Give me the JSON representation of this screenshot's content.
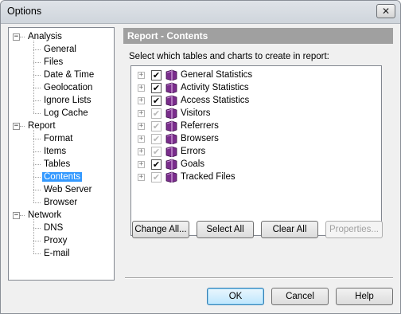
{
  "window": {
    "title": "Options",
    "close_glyph": "✕"
  },
  "tree": {
    "items": [
      {
        "label": "Analysis",
        "level": 0,
        "expander": "−"
      },
      {
        "label": "General",
        "level": 1
      },
      {
        "label": "Files",
        "level": 1
      },
      {
        "label": "Date & Time",
        "level": 1
      },
      {
        "label": "Geolocation",
        "level": 1
      },
      {
        "label": "Ignore Lists",
        "level": 1
      },
      {
        "label": "Log Cache",
        "level": 1
      },
      {
        "label": "Report",
        "level": 0,
        "expander": "−"
      },
      {
        "label": "Format",
        "level": 1
      },
      {
        "label": "Items",
        "level": 1
      },
      {
        "label": "Tables",
        "level": 1
      },
      {
        "label": "Contents",
        "level": 1,
        "selected": true
      },
      {
        "label": "Web Server",
        "level": 1
      },
      {
        "label": "Browser",
        "level": 1
      },
      {
        "label": "Network",
        "level": 0,
        "expander": "−"
      },
      {
        "label": "DNS",
        "level": 1
      },
      {
        "label": "Proxy",
        "level": 1
      },
      {
        "label": "E-mail",
        "level": 1
      }
    ]
  },
  "panel": {
    "header": "Report - Contents",
    "instruction": "Select which tables and charts to create in report:",
    "expand_glyph": "+",
    "check_glyph": "✔",
    "book_icon": "book-icon",
    "colors": {
      "book": "#7a2d8c",
      "header_bg": "#a0a0a0",
      "selection": "#3399ff"
    },
    "items": [
      {
        "label": "General Statistics",
        "checked": true
      },
      {
        "label": "Activity Statistics",
        "checked": true
      },
      {
        "label": "Access Statistics",
        "checked": true
      },
      {
        "label": "Visitors",
        "checked": true,
        "dim": true
      },
      {
        "label": "Referrers",
        "checked": true,
        "dim": true
      },
      {
        "label": "Browsers",
        "checked": true,
        "dim": true
      },
      {
        "label": "Errors",
        "checked": true,
        "dim": true
      },
      {
        "label": "Goals",
        "checked": true
      },
      {
        "label": "Tracked Files",
        "checked": true,
        "dim": true
      }
    ]
  },
  "buttons": {
    "change_all": "Change All...",
    "select_all": "Select All",
    "clear_all": "Clear All",
    "properties": "Properties...",
    "ok": "OK",
    "cancel": "Cancel",
    "help": "Help"
  }
}
